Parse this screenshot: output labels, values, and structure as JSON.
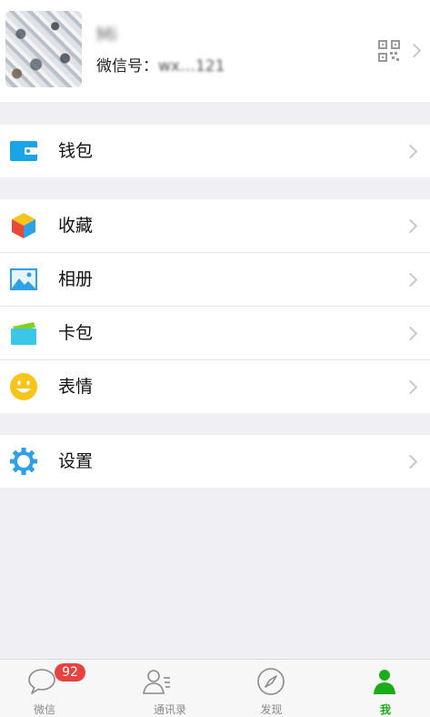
{
  "profile": {
    "name": "Mi",
    "wechat_id_label": "微信号：",
    "wechat_id_value": "wx…121",
    "qr_icon": "qr-code-icon"
  },
  "groups": [
    {
      "items": [
        {
          "label": "钱包",
          "icon": "wallet-icon",
          "color": "#1aa4e8"
        }
      ]
    },
    {
      "items": [
        {
          "label": "收藏",
          "icon": "favorites-cube-icon",
          "color": "#f0b429"
        },
        {
          "label": "相册",
          "icon": "album-picture-icon",
          "color": "#2f9fe6"
        },
        {
          "label": "卡包",
          "icon": "card-package-icon",
          "color": "#3ec6e8"
        },
        {
          "label": "表情",
          "icon": "emoji-smile-icon",
          "color": "#f6c41a"
        }
      ]
    },
    {
      "items": [
        {
          "label": "设置",
          "icon": "settings-gear-icon",
          "color": "#2f9fe6"
        }
      ]
    }
  ],
  "tabbar": {
    "tabs": [
      {
        "label": "微信",
        "icon": "chat-bubble-icon",
        "badge": "92"
      },
      {
        "label": "通讯录",
        "icon": "contacts-icon"
      },
      {
        "label": "发现",
        "icon": "compass-icon"
      },
      {
        "label": "我",
        "icon": "me-person-icon",
        "active": true
      }
    ],
    "active_color": "#1aad19"
  }
}
